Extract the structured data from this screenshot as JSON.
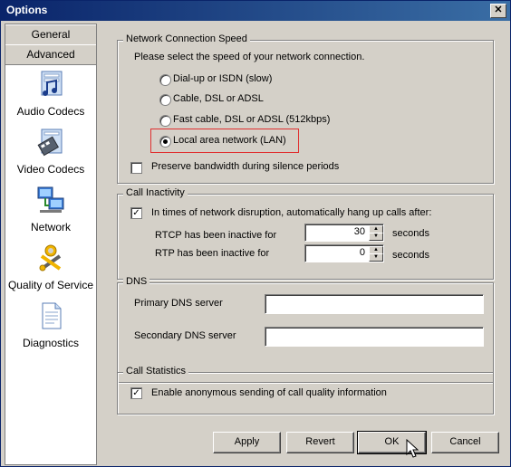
{
  "window": {
    "title": "Options",
    "close_glyph": "✕"
  },
  "sidebar": {
    "tabs": [
      {
        "label": "General"
      },
      {
        "label": "Advanced"
      }
    ],
    "items": [
      {
        "label": "Audio Codecs",
        "icon": "audio-codecs-icon"
      },
      {
        "label": "Video Codecs",
        "icon": "video-codecs-icon"
      },
      {
        "label": "Network",
        "icon": "network-icon"
      },
      {
        "label": "Quality of Service",
        "icon": "quality-of-service-icon"
      },
      {
        "label": "Diagnostics",
        "icon": "diagnostics-icon"
      }
    ]
  },
  "network_speed": {
    "legend": "Network Connection Speed",
    "prompt": "Please select the speed of your network connection.",
    "options": [
      {
        "label": "Dial-up or ISDN (slow)",
        "selected": false
      },
      {
        "label": "Cable, DSL or ADSL",
        "selected": false
      },
      {
        "label": "Fast cable, DSL or ADSL (512kbps)",
        "selected": false
      },
      {
        "label": "Local area network (LAN)",
        "selected": true
      }
    ],
    "preserve_bandwidth": {
      "label": "Preserve bandwidth during silence periods",
      "checked": false
    }
  },
  "call_inactivity": {
    "legend": "Call Inactivity",
    "auto_hangup": {
      "label": "In times of network disruption, automatically hang up calls after:",
      "checked": true
    },
    "rtcp": {
      "label": "RTCP has been inactive for",
      "value": "30",
      "unit": "seconds"
    },
    "rtp": {
      "label": "RTP has been inactive for",
      "value": "0",
      "unit": "seconds"
    }
  },
  "dns": {
    "legend": "DNS",
    "primary": {
      "label": "Primary DNS server",
      "value": ""
    },
    "secondary": {
      "label": "Secondary DNS server",
      "value": ""
    }
  },
  "call_statistics": {
    "legend": "Call Statistics",
    "anonymous": {
      "label": "Enable anonymous sending of call quality information",
      "checked": true
    }
  },
  "buttons": {
    "apply": "Apply",
    "revert": "Revert",
    "ok": "OK",
    "cancel": "Cancel"
  },
  "colors": {
    "title_start": "#0a246a",
    "title_end": "#3a6ea5",
    "highlight": "#e03030",
    "face": "#d4d0c8"
  }
}
